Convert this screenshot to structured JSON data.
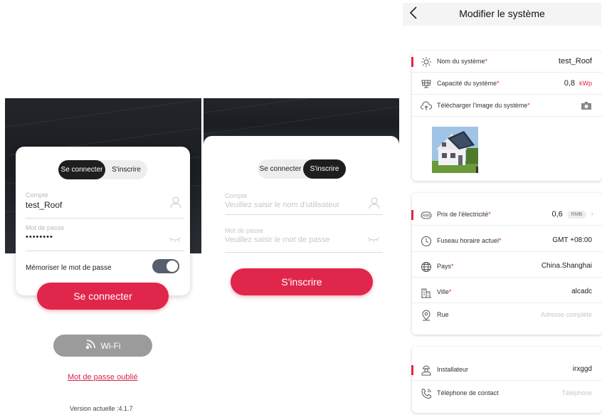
{
  "login": {
    "tab_login": "Se connecter",
    "tab_register": "S'inscrire",
    "account_label": "Compte",
    "account_value": "test_Roof",
    "password_label": "Mot de passe",
    "password_value": "••••••••",
    "remember_label": "Mémoriser le mot de passe",
    "remember_on": true,
    "login_button": "Se connecter",
    "wifi_button": "Wi-Fi",
    "forgot_link": "Mot de passe oublié",
    "version": "Version actuelle :4.1.7"
  },
  "register": {
    "tab_login": "Se connecter",
    "tab_register": "S'inscrire",
    "account_label": "Compte",
    "account_placeholder": "Veuillez saisir le nom d'utilisateur",
    "password_label": "Mot de passe",
    "password_placeholder": "Veuillez saisir le mot de passe",
    "register_button": "S'inscrire"
  },
  "system": {
    "back_icon": "chevron-left-icon",
    "title": "Modifier le système",
    "name_label": "Nom du système",
    "name_value": "test_Roof",
    "capacity_label": "Capacité du système",
    "capacity_value": "0,8",
    "capacity_unit": "kWp",
    "upload_label": "Télécharger l'image du système",
    "price_label": "Prix de l'électricité",
    "price_value": "0,6",
    "price_unit": "RMB",
    "timezone_label": "Fuseau horaire actuel",
    "timezone_value": "GMT +08:00",
    "country_label": "Pays",
    "country_value": "China.Shanghai",
    "city_label": "Ville",
    "city_value": "alcadc",
    "street_label": "Rue",
    "street_placeholder": "Adresse complète",
    "installer_label": "Installateur",
    "installer_value": "irxggd",
    "phone_label": "Téléphone de contact",
    "phone_placeholder": "Téléphone",
    "required_mark": "*"
  },
  "colors": {
    "accent": "#e0264a",
    "dark": "#1e1e1e",
    "wifi": "#9b9b9b",
    "toggle": "#55606c"
  }
}
